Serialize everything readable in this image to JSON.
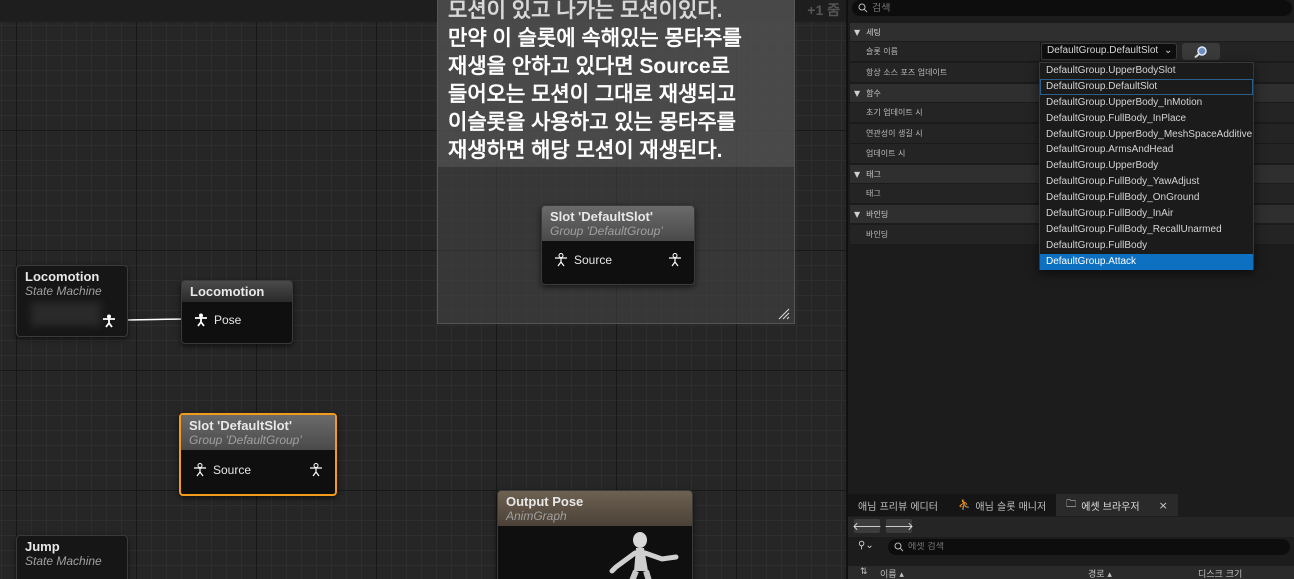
{
  "graph": {
    "zoom_label": "+1 줌",
    "comment_lines": [
      "모션이 있고 나가는 모션이있다.",
      "만약 이 슬롯에 속해있는 몽타주를",
      "재생을 안하고 있다면 Source로",
      "들어오는 모션이 그대로 재생되고",
      "이슬롯을 사용하고 있는 몽타주를",
      "재생하면 해당 모션이 재생된다."
    ],
    "nodes": {
      "locomotion_sm": {
        "title": "Locomotion",
        "subtitle": "State Machine"
      },
      "locomotion_pose": {
        "title": "Locomotion",
        "pin": "Pose"
      },
      "slot_a": {
        "title": "Slot 'DefaultSlot'",
        "subtitle": "Group 'DefaultGroup'",
        "pin": "Source"
      },
      "slot_b": {
        "title": "Slot 'DefaultSlot'",
        "subtitle": "Group 'DefaultGroup'",
        "pin": "Source"
      },
      "output_pose": {
        "title": "Output Pose",
        "subtitle": "AnimGraph"
      },
      "jump_sm": {
        "title": "Jump",
        "subtitle": "State Machine"
      }
    }
  },
  "details": {
    "search_placeholder": "검색",
    "sections": [
      {
        "label": "세팅",
        "rows": [
          "슬롯 이름",
          "항상 소스 포즈 업데이트"
        ]
      },
      {
        "label": "함수",
        "rows": [
          "초기 업데이트 시",
          "연관성이 생길 시",
          "업데이트 시"
        ]
      },
      {
        "label": "태그",
        "rows": [
          "태그"
        ]
      },
      {
        "label": "바인딩",
        "rows": [
          "바인딩"
        ]
      }
    ],
    "slot_value": "DefaultGroup.DefaultSlot",
    "dropdown_items": [
      "DefaultGroup.UpperBodySlot",
      "DefaultGroup.DefaultSlot",
      "DefaultGroup.UpperBody_InMotion",
      "DefaultGroup.FullBody_InPlace",
      "DefaultGroup.UpperBody_MeshSpaceAdditive",
      "DefaultGroup.ArmsAndHead",
      "DefaultGroup.UpperBody",
      "DefaultGroup.FullBody_YawAdjust",
      "DefaultGroup.FullBody_OnGround",
      "DefaultGroup.FullBody_InAir",
      "DefaultGroup.FullBody_RecallUnarmed",
      "DefaultGroup.FullBody",
      "DefaultGroup.Attack"
    ],
    "dropdown_current_index": 1,
    "dropdown_hover_index": 12
  },
  "bottom": {
    "tabs": [
      "애님 프리뷰 에디터",
      "애님 슬롯 매니저",
      "에셋 브라우저"
    ],
    "asset_search_placeholder": "에셋 검색",
    "columns": [
      "이름",
      "경로",
      "디스크 크기"
    ]
  },
  "colors": {
    "selected_outline": "#f39b1a",
    "dropdown_hover": "#0e70c0",
    "output_pose_header": "#6e6152"
  }
}
